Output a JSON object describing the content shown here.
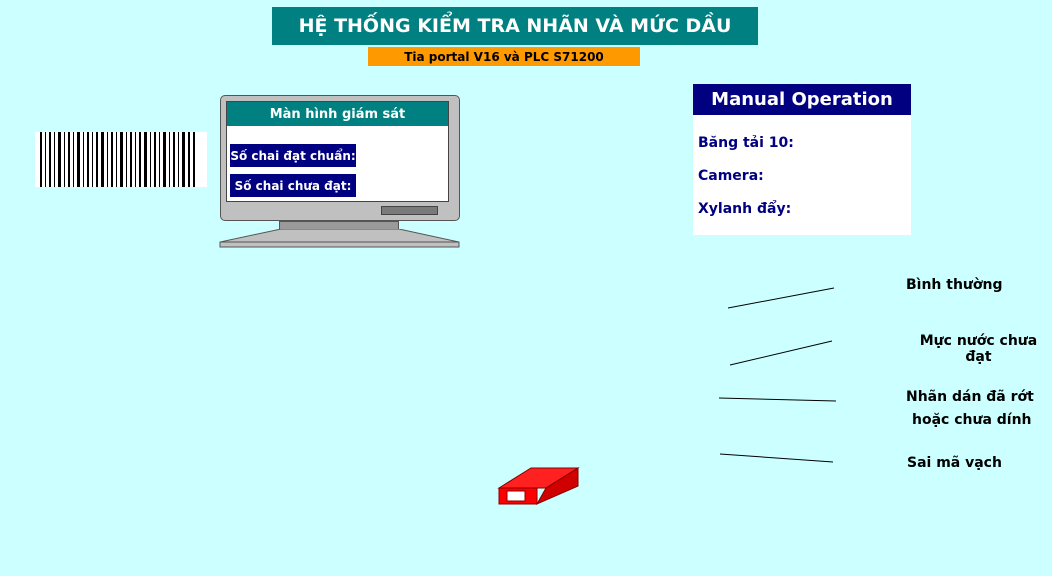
{
  "header": {
    "title": "HỆ THỐNG KIỂM TRA NHÃN VÀ MỨC DẦU",
    "subtitle": "Tia portal V16 và PLC S71200"
  },
  "monitor": {
    "title": "Màn hình giám sát",
    "good_bottles_label": "Số chai đạt chuẩn:",
    "bad_bottles_label": "Số chai chưa đạt:"
  },
  "manual": {
    "title": "Manual Operation",
    "items": [
      "Băng tải 10:",
      "Camera:",
      "Xylanh đẩy:"
    ]
  },
  "legend": {
    "items": [
      "Bình thường",
      "Mực nước chưa đạt",
      "Nhãn dán đã rớt",
      "hoặc chưa dính",
      "Sai mã vạch"
    ]
  },
  "colors": {
    "background": "#ccffff",
    "teal": "#008080",
    "orange": "#ff9900",
    "navy": "#000080",
    "red_sensor": "#ff0000"
  },
  "icons": {
    "barcode": "barcode-icon",
    "monitor": "monitor-icon",
    "sensor": "red-sensor-block-icon"
  }
}
